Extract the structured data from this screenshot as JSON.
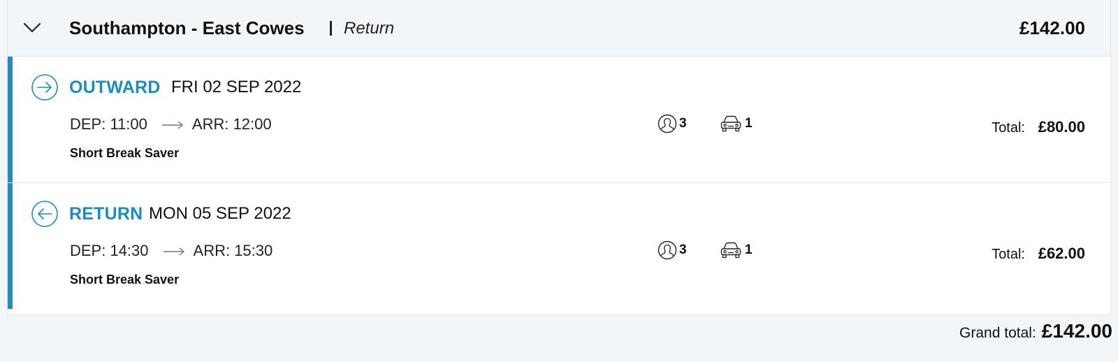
{
  "summary": {
    "route": "Southampton - East Cowes",
    "trip_type": "Return",
    "total": "£142.00",
    "chevron_icon": "chevron-down-icon"
  },
  "legs": [
    {
      "label": "OUTWARD",
      "date": "FRI 02 SEP 2022",
      "icon": "arrow-right-circle-icon",
      "departure": "DEP: 11:00",
      "arrival": "ARR: 12:00",
      "fare": "Short Break Saver",
      "passengers": "3",
      "vehicles": "1",
      "total_label": "Total:",
      "total": "£80.00"
    },
    {
      "label": "RETURN",
      "date": "MON 05 SEP 2022",
      "icon": "arrow-left-circle-icon",
      "departure": "DEP: 14:30",
      "arrival": "ARR: 15:30",
      "fare": "Short Break Saver",
      "passengers": "3",
      "vehicles": "1",
      "total_label": "Total:",
      "total": "£62.00"
    }
  ],
  "grand_total": {
    "label": "Grand total:",
    "value": "£142.00"
  },
  "colors": {
    "accent": "#1590c8",
    "leg_label": "#1b8cc4",
    "header_bg": "#f3f6f9"
  }
}
